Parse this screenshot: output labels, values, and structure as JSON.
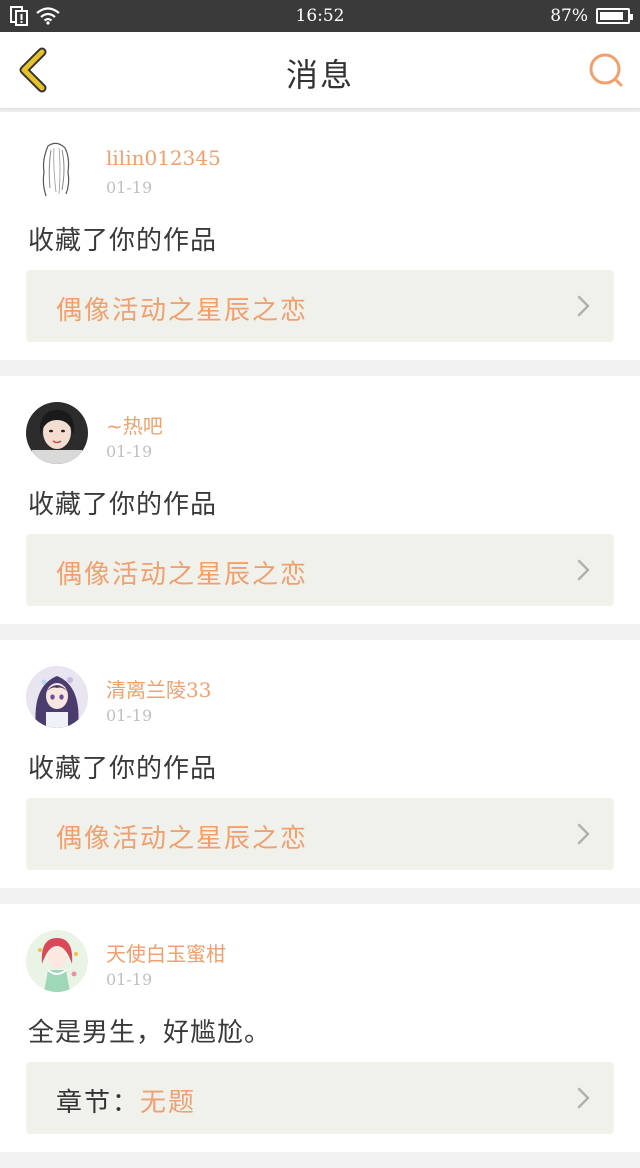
{
  "status_bar": {
    "time": "16:52",
    "battery_percent": "87%",
    "battery_level": 0.87
  },
  "header": {
    "title": "消息",
    "back_icon": "chevron-left-icon",
    "search_icon": "search-icon"
  },
  "colors": {
    "accent": "#f0a06e",
    "back_icon": "#e6c12a",
    "status_bar_bg": "#3a3a3a",
    "card_link_bg": "#f1f1ec"
  },
  "messages": [
    {
      "username": "lilin012345",
      "date": "01-19",
      "action": "收藏了你的作品",
      "link_prefix": "",
      "link_text": "偶像活动之星辰之恋"
    },
    {
      "username": "~热吧",
      "date": "01-19",
      "action": "收藏了你的作品",
      "link_prefix": "",
      "link_text": "偶像活动之星辰之恋"
    },
    {
      "username": "清离兰陵33",
      "date": "01-19",
      "action": "收藏了你的作品",
      "link_prefix": "",
      "link_text": "偶像活动之星辰之恋"
    },
    {
      "username": "天使白玉蜜柑",
      "date": "01-19",
      "action": "全是男生，好尴尬。",
      "link_prefix": "章节：",
      "link_text": "无题"
    }
  ]
}
